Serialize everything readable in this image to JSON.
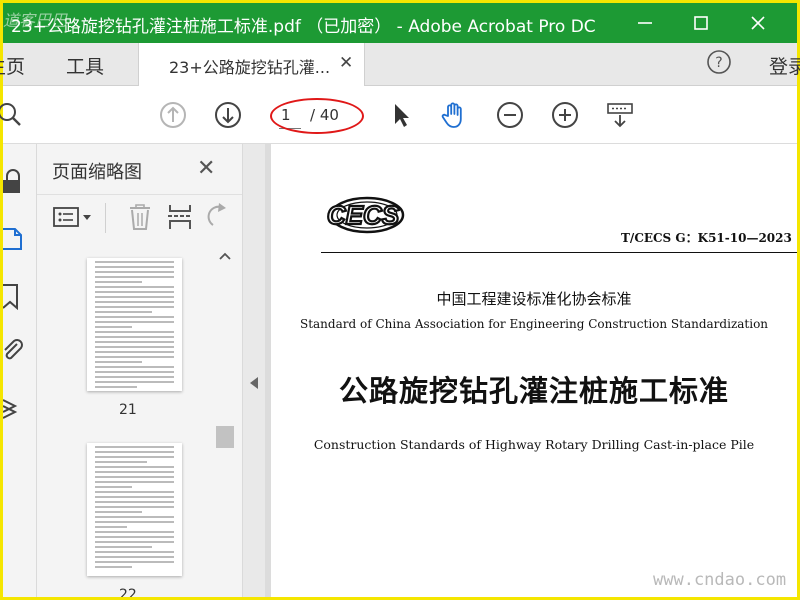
{
  "window": {
    "title": "23+公路旋挖钻孔灌注桩施工标准.pdf （已加密） - Adobe Acrobat Pro DC",
    "logo_watermark": "道客巴巴"
  },
  "tabs": {
    "home_label": "主页",
    "tools_label": "工具",
    "doc_label": "23+公路旋挖钻孔灌...",
    "login_label": "登录"
  },
  "toolbar": {
    "current_page": "1",
    "total_pages": "/ 40"
  },
  "panel": {
    "title": "页面缩略图",
    "thumbnails": [
      {
        "label": "21"
      },
      {
        "label": "22"
      }
    ]
  },
  "document": {
    "logo": "CECS",
    "standard_number": "T/CECS G：K51-10—2023",
    "org_cn": "中国工程建设标准化协会标准",
    "org_en": "Standard of China Association for Engineering Construction Standardization",
    "title_cn": "公路旋挖钻孔灌注桩施工标准",
    "title_en": "Construction Standards of Highway Rotary Drilling Cast-in-place Pile"
  },
  "site_watermark": "www.cndao.com",
  "colors": {
    "titlebar": "#1d9a34",
    "frame": "#f5e600",
    "annotation": "#e01818",
    "hand_tool": "#1f6fd1"
  },
  "icons": {
    "rail": [
      "lock-icon",
      "pages-icon",
      "bookmark-icon",
      "attachment-icon",
      "layers-icon"
    ],
    "toolbar": [
      "search-icon",
      "page-up-icon",
      "page-down-icon",
      "select-arrow-icon",
      "hand-icon",
      "zoom-out-icon",
      "zoom-in-icon",
      "keyboard-icon"
    ]
  }
}
